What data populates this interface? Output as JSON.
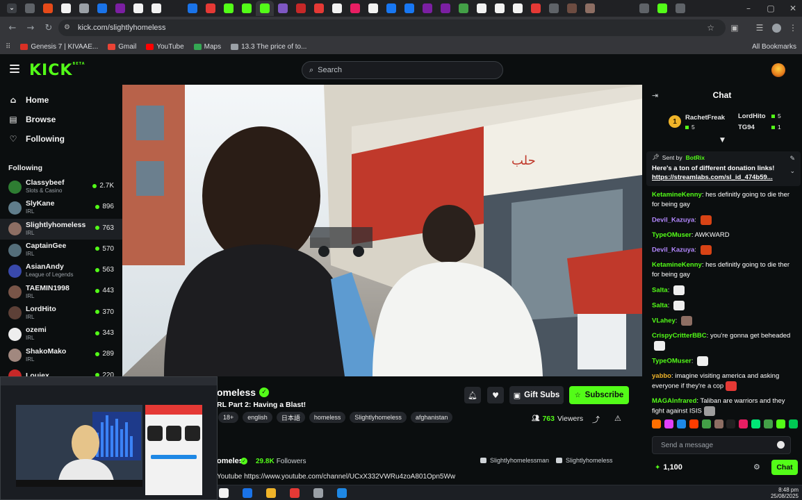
{
  "browser": {
    "url": "kick.com/slightlyhomeless",
    "bookmarks": [
      {
        "label": "Genesis 7 | KIVAAE...",
        "color": "#d93025"
      },
      {
        "label": "Gmail",
        "color": "#ea4335"
      },
      {
        "label": "YouTube",
        "color": "#ff0000"
      },
      {
        "label": "Maps",
        "color": "#34a853"
      },
      {
        "label": "13.3 The price of to...",
        "color": "#9aa0a6"
      }
    ],
    "all_bookmarks": "All Bookmarks",
    "tab_colors": [
      "#5f6368",
      "#e64a19",
      "#f2f2f2",
      "#9aa0a6",
      "#1a73e8",
      "#7b1fa2",
      "#f2f2f2",
      "#f2f2f2",
      "#202124",
      "#1a73e8",
      "#e53935",
      "#53fc18",
      "#53fc18",
      "#53fc18",
      "#7e57c2",
      "#c62828",
      "#e53935",
      "#f2f2f2",
      "#e91e63",
      "#f2f2f2",
      "#1877f2",
      "#1877f2",
      "#7b1fa2",
      "#7b1fa2",
      "#43a047",
      "#f2f2f2",
      "#f2f2f2",
      "#f2f2f2",
      "#e53935",
      "#5f6368",
      "#6d4c41",
      "#8d6e63",
      "#202124",
      "#202124",
      "#5f6368",
      "#53fc18",
      "#5f6368"
    ]
  },
  "header": {
    "logo": "KICK",
    "logo_sup": "BETA",
    "search_placeholder": "Search"
  },
  "sidebar": {
    "nav": [
      {
        "label": "Home",
        "icon": "home-icon",
        "glyph": "⌂"
      },
      {
        "label": "Browse",
        "icon": "browse-icon",
        "glyph": "▤"
      },
      {
        "label": "Following",
        "icon": "heart-icon",
        "glyph": "♡"
      }
    ],
    "following_title": "Following",
    "channels": [
      {
        "name": "Classybeef",
        "category": "Slots & Casino",
        "viewers": "2.7K",
        "color": "#2e7d32"
      },
      {
        "name": "SlyKane",
        "category": "IRL",
        "viewers": "896",
        "color": "#607d8b"
      },
      {
        "name": "Slightlyhomeless",
        "category": "IRL",
        "viewers": "763",
        "color": "#8d6e63",
        "selected": true
      },
      {
        "name": "CaptainGee",
        "category": "IRL",
        "viewers": "570",
        "color": "#546e7a"
      },
      {
        "name": "AsianAndy",
        "category": "League of Legends",
        "viewers": "563",
        "color": "#3949ab"
      },
      {
        "name": "TAEMIN1998",
        "category": "IRL",
        "viewers": "443",
        "color": "#795548"
      },
      {
        "name": "LordHito",
        "category": "IRL",
        "viewers": "370",
        "color": "#5d4037"
      },
      {
        "name": "ozemi",
        "category": "IRL",
        "viewers": "343",
        "color": "#eeeeee"
      },
      {
        "name": "ShakoMako",
        "category": "IRL",
        "viewers": "289",
        "color": "#a1887f"
      },
      {
        "name": "Louiex",
        "category": "",
        "viewers": "220",
        "color": "#c62828"
      }
    ]
  },
  "stream": {
    "name_visible": "omeless",
    "title_visible": "RL Part 2: Having a Blast!",
    "tags": [
      "18+",
      "english",
      "日本語",
      "homeless",
      "Slightlyhomeless",
      "afghanistan"
    ],
    "gift_label": "Gift Subs",
    "subscribe_label": "Subscribe",
    "viewer_count": "763",
    "viewers_label": "Viewers",
    "about_name_visible": "omeless",
    "followers_count": "29.8K",
    "followers_label": "Followers",
    "social_1": "Slightlyhomelessman",
    "social_2": "Slightlyhomeless",
    "about_link": "Youtube https://www.youtube.com/channel/UCxX332VWRu4zoA801Opn5Ww"
  },
  "chat": {
    "title": "Chat",
    "leaderboard": [
      {
        "name": "RachetFreak",
        "count": "5",
        "color": "#f0b429"
      },
      {
        "name": "LordHito",
        "count": "5",
        "color": "#cfd3d7"
      },
      {
        "name": "TG94",
        "count": "1",
        "color": "#e57a1c"
      }
    ],
    "rank_badge": "1",
    "pinned": {
      "sent_by": "Sent by",
      "bot": "BotRix",
      "message": "Here's a ton of different donation links!",
      "link": "https://streamlabs.com/sl_id_474b59..."
    },
    "messages": [
      {
        "user": "KetamineKenny",
        "color": "#53fc18",
        "text": "hes definitly going to die ther for being gay"
      },
      {
        "user": "Devil_Kazuya",
        "color": "#b388ff",
        "text": "",
        "emote": "#d84315"
      },
      {
        "user": "TypeOMuser",
        "color": "#53fc18",
        "text": "AWKWARD"
      },
      {
        "user": "Devil_Kazuya",
        "color": "#b388ff",
        "text": "",
        "emote": "#d84315"
      },
      {
        "user": "KetamineKenny",
        "color": "#53fc18",
        "text": "hes definitly going to die ther for being gay"
      },
      {
        "user": "Salta",
        "color": "#53fc18",
        "text": "",
        "emote": "#eeeeee"
      },
      {
        "user": "Salta",
        "color": "#53fc18",
        "text": "",
        "emote": "#eeeeee"
      },
      {
        "user": "VLahey",
        "color": "#53fc18",
        "text": "",
        "emote": "#8d6e63"
      },
      {
        "user": "CrispyCritterBBC",
        "color": "#53fc18",
        "text": "you're gonna get beheaded",
        "emote": "#eeeeee"
      },
      {
        "user": "TypeOMuser",
        "color": "#53fc18",
        "text": "",
        "emote": "#eeeeee"
      },
      {
        "user": "yabbo",
        "color": "#f0b429",
        "text": "imagine visiting america and asking everyone if they're a cop",
        "emote": "#e53935"
      },
      {
        "user": "MAGAInfrared",
        "color": "#53fc18",
        "text": "Taliban are warriors and they fight against ISIS",
        "emote": "#9e9e9e"
      }
    ],
    "emote_bar": [
      "#ff6f00",
      "#e040fb",
      "#1e88e5",
      "#ff3d00",
      "#43a047",
      "#8d6e63",
      "#212121",
      "#e91e63",
      "#00e676",
      "#43a047",
      "#53fc18",
      "#00c853"
    ],
    "input_placeholder": "Send a message",
    "points": "1,100",
    "send_label": "Chat"
  },
  "taskbar": {
    "time": "8:48 pm",
    "date": "25/08/2025",
    "apps": [
      "#f2f2f2",
      "#1a73e8",
      "#f0b429",
      "#e53935",
      "#9aa0a6",
      "#1e88e5"
    ]
  }
}
